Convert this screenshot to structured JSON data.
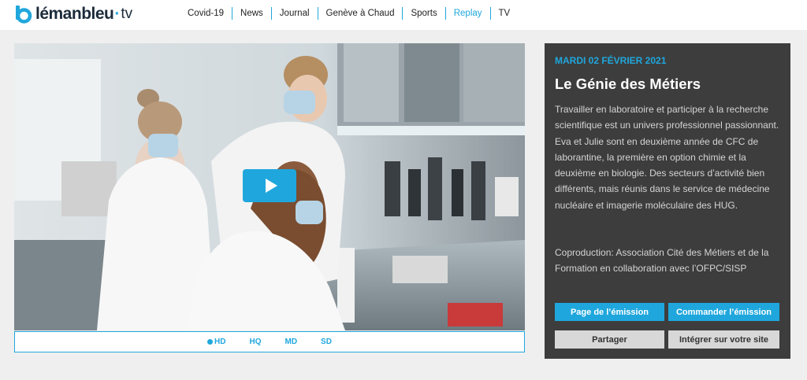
{
  "brand": {
    "name": "lémanbleu",
    "dot": "·",
    "suffix": "tv",
    "accent": "#1fa7dd"
  },
  "nav": [
    {
      "label": "Covid-19",
      "active": false
    },
    {
      "label": "News",
      "active": false
    },
    {
      "label": "Journal",
      "active": false
    },
    {
      "label": "Genève à Chaud",
      "active": false
    },
    {
      "label": "Sports",
      "active": false
    },
    {
      "label": "Replay",
      "active": true
    },
    {
      "label": "TV",
      "active": false
    }
  ],
  "player": {
    "quality": [
      "HD",
      "HQ",
      "MD",
      "SD"
    ],
    "selected_quality": "HD"
  },
  "episode": {
    "date": "MARDI 02 FÉVRIER 2021",
    "title": "Le Génie des Métiers",
    "description": "Travailler en laboratoire et participer à la recherche scientifique est un univers professionnel passionnant. Eva et Julie sont en deuxième année de CFC de laborantine, la première en option chimie et la deuxième en biologie. Des secteurs d’activité bien différents, mais réunis dans le service de médecine nucléaire et imagerie moléculaire des HUG.",
    "coproduction": "Coproduction: Association Cité des Métiers et de la Formation en collaboration avec l’OFPC/SISP"
  },
  "actions": {
    "show_page": "Page de l’émission",
    "order": "Commander l’émission",
    "share": "Partager",
    "embed": "Intégrer sur votre site"
  }
}
